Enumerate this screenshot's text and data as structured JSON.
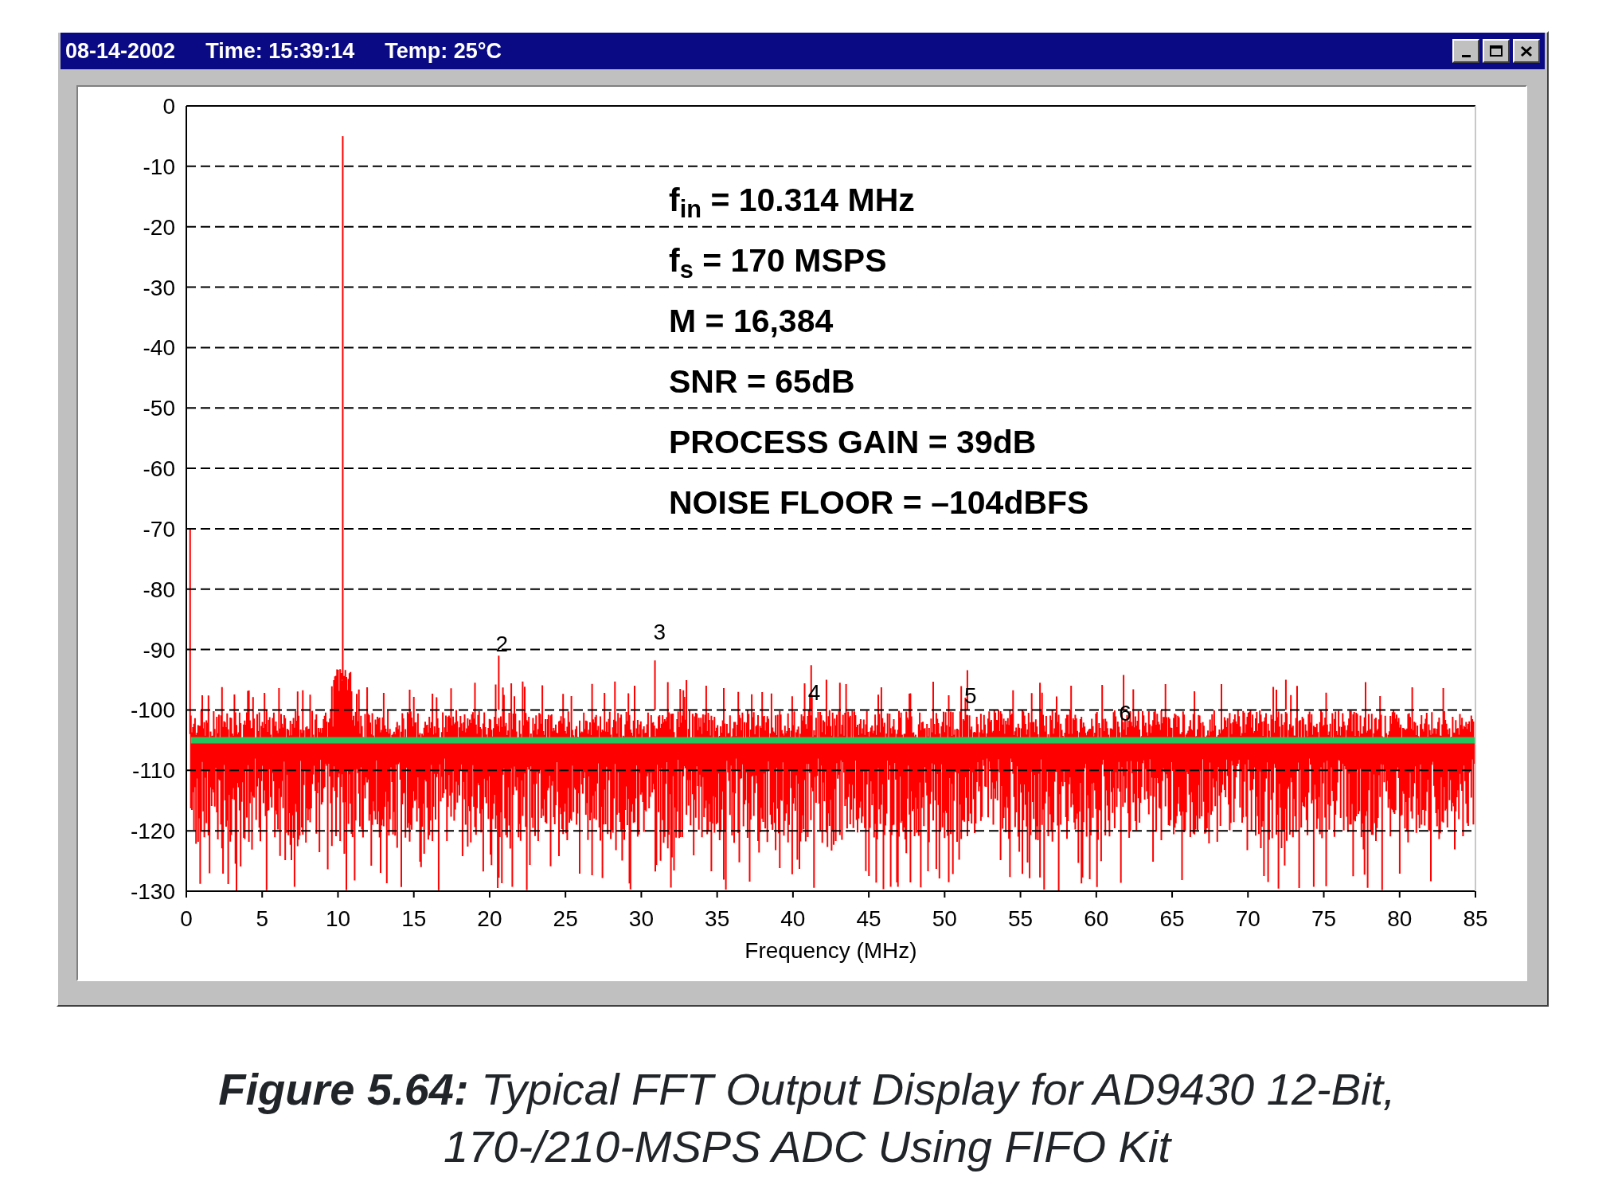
{
  "window": {
    "title_fields": [
      "08-14-2002",
      "Time: 15:39:14",
      "Temp: 25°C"
    ],
    "controls": [
      {
        "kind": "minimize"
      },
      {
        "kind": "maximize"
      },
      {
        "kind": "close"
      }
    ]
  },
  "chart": {
    "stats": [
      "f$_{in}$ = 10.314 MHz",
      "f$_{s}$ = 170 MSPS",
      "M = 16,384",
      "SNR = 65dB",
      "PROCESS GAIN = 39dB",
      "NOISE FLOOR = –104dBFS"
    ],
    "chart_data": {
      "type": "line",
      "xlabel": "Frequency (MHz)",
      "xlim": [
        0,
        85
      ],
      "ylim": [
        -130,
        0
      ],
      "xticks": [
        0,
        5,
        10,
        15,
        20,
        25,
        30,
        35,
        40,
        45,
        50,
        55,
        60,
        65,
        70,
        75,
        80,
        85
      ],
      "yticks": [
        0,
        -10,
        -20,
        -30,
        -40,
        -50,
        -60,
        -70,
        -80,
        -90,
        -100,
        -110,
        -120,
        -130
      ],
      "x": [
        0.3,
        85
      ],
      "grid": true,
      "series": [
        {
          "color": "#22c55e",
          "values": [
            -105,
            -105
          ]
        }
      ],
      "annotations": [
        "2",
        "3",
        "4",
        "5",
        "6"
      ]
    }
  },
  "caption": "**Figure 5.64:** Typical FFT Output Display for AD9430 12-Bit, 170-/210-MSPS ADC Using FIFO Kit"
}
